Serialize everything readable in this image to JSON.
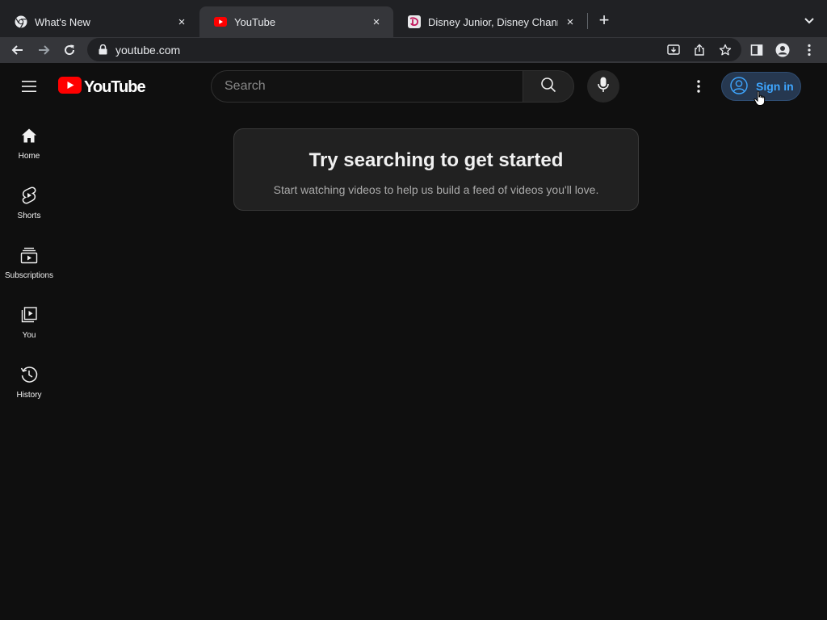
{
  "browser": {
    "tabs": [
      {
        "title": "What's New",
        "favicon": "chrome-icon",
        "active": false
      },
      {
        "title": "YouTube",
        "favicon": "youtube-icon",
        "active": true
      },
      {
        "title": "Disney Junior, Disney Channel,",
        "favicon": "disney-icon",
        "active": false
      }
    ],
    "new_tab_label": "+",
    "close_label": "×",
    "url": "youtube.com"
  },
  "masthead": {
    "logo_text": "YouTube",
    "search_placeholder": "Search",
    "signin_label": "Sign in"
  },
  "guide": {
    "items": [
      {
        "label": "Home",
        "icon": "home-icon"
      },
      {
        "label": "Shorts",
        "icon": "shorts-icon"
      },
      {
        "label": "Subscriptions",
        "icon": "subscriptions-icon"
      },
      {
        "label": "You",
        "icon": "you-library-icon"
      },
      {
        "label": "History",
        "icon": "history-icon"
      }
    ]
  },
  "feed": {
    "heading": "Try searching to get started",
    "subtext": "Start watching videos to help us build a feed of videos you'll love."
  },
  "colors": {
    "background": "#0f0f0f",
    "brand_red": "#ff0000",
    "signin_blue": "#3ea6ff"
  }
}
